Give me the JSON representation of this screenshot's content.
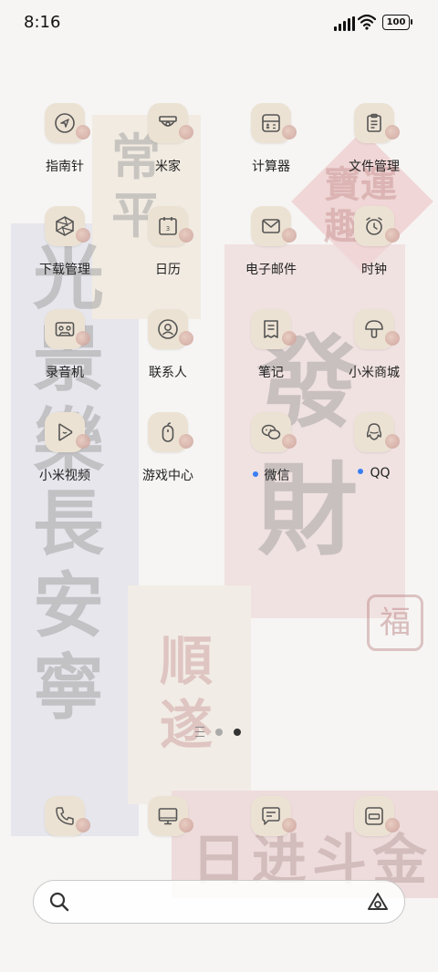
{
  "status_bar": {
    "time": "8:16",
    "battery": "100"
  },
  "apps": [
    {
      "label": "指南针",
      "icon": "compass-icon"
    },
    {
      "label": "米家",
      "icon": "camera-dome-icon"
    },
    {
      "label": "计算器",
      "icon": "calculator-icon"
    },
    {
      "label": "文件管理",
      "icon": "clipboard-icon"
    },
    {
      "label": "下载管理",
      "icon": "aperture-icon"
    },
    {
      "label": "日历",
      "icon": "calendar-icon",
      "day": "3"
    },
    {
      "label": "电子邮件",
      "icon": "mail-icon"
    },
    {
      "label": "时钟",
      "icon": "alarm-clock-icon"
    },
    {
      "label": "录音机",
      "icon": "cassette-icon"
    },
    {
      "label": "联系人",
      "icon": "contact-icon"
    },
    {
      "label": "笔记",
      "icon": "receipt-icon"
    },
    {
      "label": "小米商城",
      "icon": "mushroom-icon"
    },
    {
      "label": "小米视频",
      "icon": "play-icon"
    },
    {
      "label": "游戏中心",
      "icon": "mouse-icon"
    },
    {
      "label": "微信",
      "icon": "wechat-icon",
      "new": true
    },
    {
      "label": "QQ",
      "icon": "qq-icon",
      "new": true
    }
  ],
  "dock": [
    {
      "icon": "phone-icon"
    },
    {
      "icon": "monitor-icon"
    },
    {
      "icon": "message-icon"
    },
    {
      "icon": "camera-icon"
    }
  ],
  "pager": {
    "pages": 2,
    "current": 2
  },
  "wallpaper_text": [
    "光景樂長安寧",
    "常平",
    "發財",
    "寶運趣",
    "順遂",
    "日进斗金",
    "福"
  ],
  "colors": {
    "accent_dot": "#3a7ef5",
    "icon_bg": "#ece2d3"
  }
}
